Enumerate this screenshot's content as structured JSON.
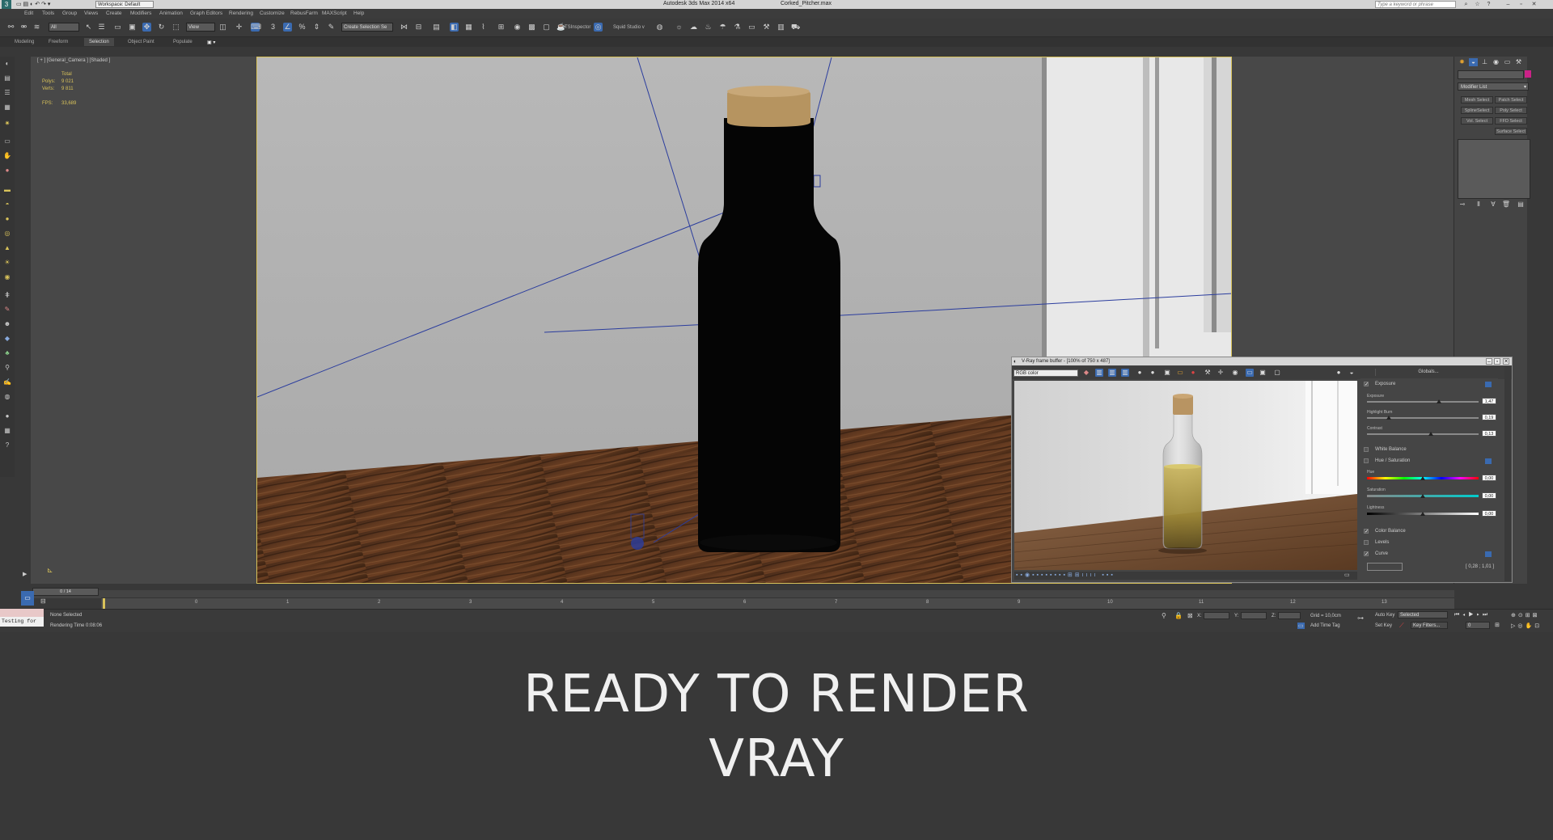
{
  "window": {
    "app_title": "Autodesk 3ds Max  2014 x64",
    "file_name": "Corked_Pitcher.max",
    "workspace": "Workspace: Default",
    "search_placeholder": "Type a keyword or phrase"
  },
  "menu": [
    "Edit",
    "Tools",
    "Group",
    "Views",
    "Create",
    "Modifiers",
    "Animation",
    "Graph Editors",
    "Rendering",
    "Customize",
    "RebusFarm",
    "MAXScript",
    "Help"
  ],
  "toolbar": {
    "filter_dropdown": "All",
    "ref_coord_dropdown": "View",
    "named_selection": "Create Selection Se",
    "tsinspector": "TSInspector",
    "squid_studio": "Squid Studio v"
  },
  "ribbon": {
    "tabs": [
      "Modeling",
      "Freeform",
      "Selection",
      "Object Paint",
      "Populate"
    ],
    "active_index": 2
  },
  "viewport": {
    "label": "[ + ] [General_Camera ] [Shaded ]",
    "stats": {
      "header": "Total",
      "polys_label": "Polys:",
      "polys_value": "9 021",
      "verts_label": "Verts:",
      "verts_value": "9 811",
      "fps_label": "FPS:",
      "fps_value": "33,689"
    }
  },
  "command_panel": {
    "modifier_list": "Modifier List",
    "buttons": [
      "Mesh Select",
      "Patch Select",
      "SplineSelect",
      "Poly Select",
      "Vol. Select",
      "FFD Select",
      "",
      "Surface Select"
    ],
    "color_swatch": "#cc2288"
  },
  "timeline": {
    "slider_label": "0 / 14",
    "ticks": [
      "0",
      "1",
      "2",
      "3",
      "4",
      "5",
      "6",
      "7",
      "8",
      "9",
      "10",
      "11",
      "12",
      "13"
    ]
  },
  "status": {
    "listener_text": "Testing for",
    "selection": "None Selected",
    "rendering_time": "Rendering Time  0:08:06",
    "x_label": "X:",
    "y_label": "Y:",
    "z_label": "Z:",
    "grid": "Grid = 10,0cm",
    "add_time_tag": "Add Time Tag",
    "auto_key": "Auto Key",
    "set_key": "Set Key",
    "selected": "Selected",
    "key_filters": "Key Filters...",
    "frame": "0"
  },
  "vfb": {
    "title": "V-Ray frame buffer - [100% of 750 x 487]",
    "channel": "RGB color",
    "globals": "Globals...",
    "rows": {
      "exposure": "Exposure",
      "exposure_sub": "Exposure",
      "exposure_val": "1,47",
      "highlight_sub": "Highlight Burn",
      "highlight_val": "0,19",
      "contrast_sub": "Contrast",
      "contrast_val": "0,13",
      "white_balance": "White Balance",
      "hue_sat": "Hue / Saturation",
      "hue_sub": "Hue",
      "hue_val": "0,00",
      "sat_sub": "Saturation",
      "sat_val": "0,00",
      "light_sub": "Lightness",
      "light_val": "0,00",
      "color_balance": "Color Balance",
      "levels": "Levels",
      "curve": "Curve",
      "curve_coords": "[ 0,28 ; 1,01 ]"
    }
  },
  "caption": {
    "line1": "READY TO RENDER",
    "line2": "VRAY"
  }
}
